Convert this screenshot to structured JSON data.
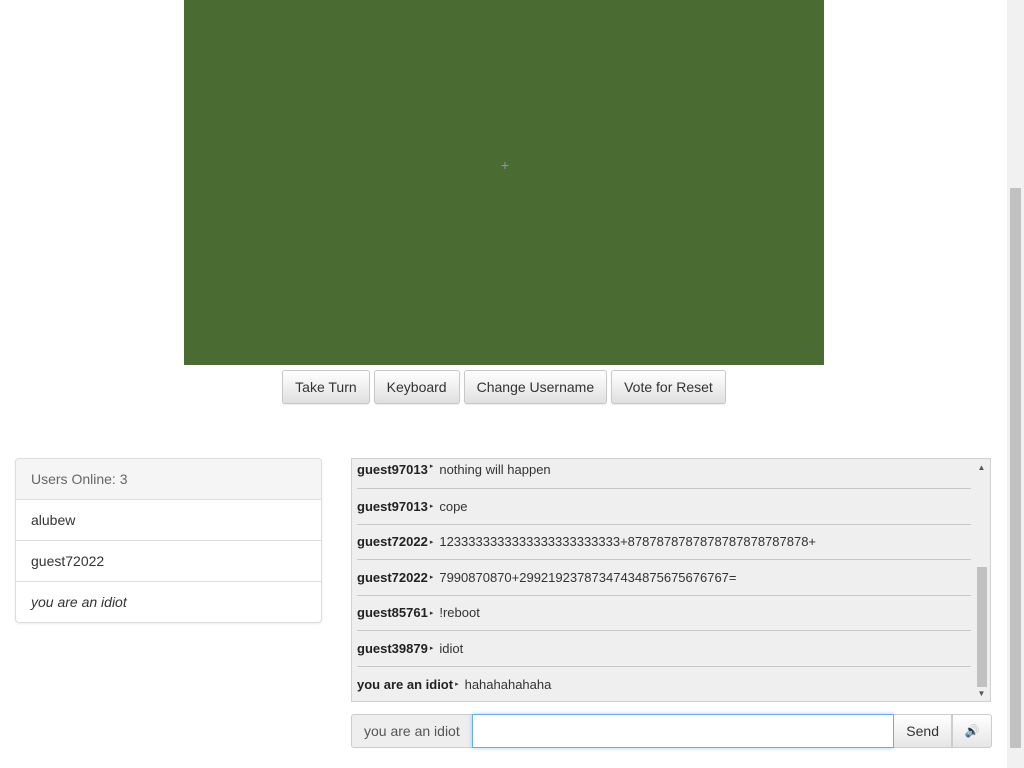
{
  "vm": {
    "buttons": [
      {
        "label": "Take Turn"
      },
      {
        "label": "Keyboard"
      },
      {
        "label": "Change Username"
      },
      {
        "label": "Vote for Reset"
      }
    ]
  },
  "users": {
    "heading": "Users Online: 3",
    "list": [
      "alubew",
      "guest72022",
      "you are an idiot"
    ]
  },
  "chat": {
    "messages": [
      {
        "user": "guest97013",
        "text": "nothing will happen"
      },
      {
        "user": "guest97013",
        "text": "cope"
      },
      {
        "user": "guest72022",
        "text": "1233333333333333333333333+8787878787878787878787878+"
      },
      {
        "user": "guest72022",
        "text": "7990870870+29921923787347434875675676767="
      },
      {
        "user": "guest85761",
        "text": "!reboot"
      },
      {
        "user": "guest39879",
        "text": "idiot"
      },
      {
        "user": "you are an idiot",
        "text": "hahahahahaha"
      }
    ],
    "username": "you are an idiot",
    "input_value": "",
    "send_label": "Send",
    "sound_icon": "speaker-icon"
  },
  "colors": {
    "vm_screen": "#4a6b32",
    "input_focus": "#66afe9"
  }
}
